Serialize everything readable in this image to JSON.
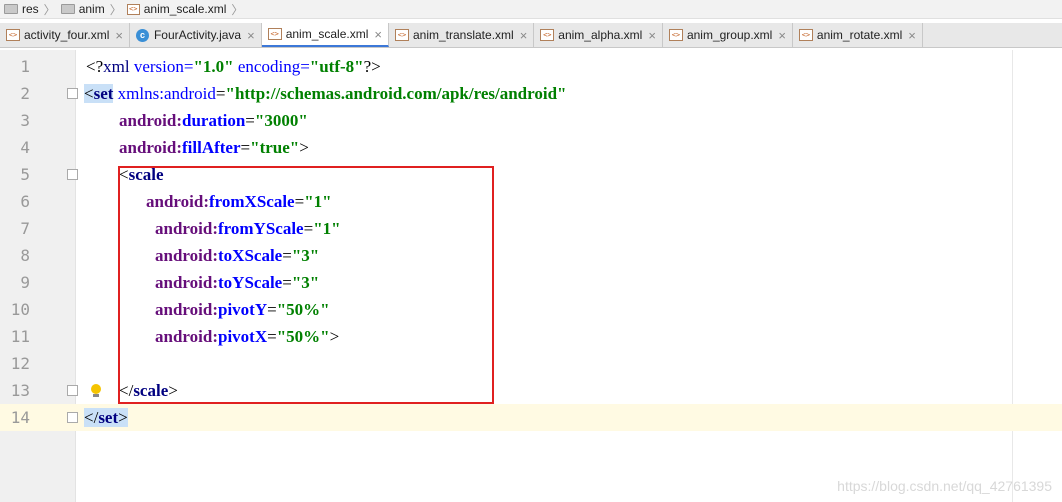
{
  "breadcrumb": [
    {
      "label": "res",
      "icon": "folder-icon"
    },
    {
      "label": "anim",
      "icon": "folder-icon"
    },
    {
      "label": "anim_scale.xml",
      "icon": "xml-file-icon"
    }
  ],
  "tabs": [
    {
      "label": "activity_four.xml",
      "icon": "xml-file-icon",
      "active": false
    },
    {
      "label": "FourActivity.java",
      "icon": "java-class-icon",
      "active": false
    },
    {
      "label": "anim_scale.xml",
      "icon": "xml-file-icon",
      "active": true
    },
    {
      "label": "anim_translate.xml",
      "icon": "xml-file-icon",
      "active": false
    },
    {
      "label": "anim_alpha.xml",
      "icon": "xml-file-icon",
      "active": false
    },
    {
      "label": "anim_group.xml",
      "icon": "xml-file-icon",
      "active": false
    },
    {
      "label": "anim_rotate.xml",
      "icon": "xml-file-icon",
      "active": false
    }
  ],
  "close_glyph": "×",
  "line_numbers": [
    "1",
    "2",
    "3",
    "4",
    "5",
    "6",
    "7",
    "8",
    "9",
    "10",
    "11",
    "12",
    "13",
    "14"
  ],
  "code": {
    "l1_open": "<?",
    "l1_xml": "xml",
    "l1_version_attr": " version=",
    "l1_version_val": "\"1.0\"",
    "l1_encoding_attr": " encoding=",
    "l1_encoding_val": "\"utf-8\"",
    "l1_close": "?>",
    "l2_lt": "<",
    "l2_tag": "set",
    "l2_ns": " xmlns:",
    "l2_nsname": "android",
    "l2_eq": "=",
    "l2_val": "\"http://schemas.android.com/apk/res/android\"",
    "l3_ns": "android:",
    "l3_name": "duration",
    "l3_val": "\"3000\"",
    "l4_ns": "android:",
    "l4_name": "fillAfter",
    "l4_val": "\"true\"",
    "l4_gt": ">",
    "l5_lt": "<",
    "l5_tag": "scale",
    "l6_ns": "android:",
    "l6_name": "fromXScale",
    "l6_val": "\"1\"",
    "l7_ns": "android:",
    "l7_name": "fromYScale",
    "l7_val": "\"1\"",
    "l8_ns": "android:",
    "l8_name": "toXScale",
    "l8_val": "\"3\"",
    "l9_ns": "android:",
    "l9_name": "toYScale",
    "l9_val": "\"3\"",
    "l10_ns": "android:",
    "l10_name": "pivotY",
    "l10_val": "\"50%\"",
    "l11_ns": "android:",
    "l11_name": "pivotX",
    "l11_val": "\"50%\"",
    "l11_gt": ">",
    "l13_open": "</",
    "l13_tag": "scale",
    "l13_gt": ">",
    "l14_open": "</",
    "l14_tag": "set",
    "l14_gt": ">",
    "eq": "="
  },
  "watermark": "https://blog.csdn.net/qq_42761395",
  "colors": {
    "tag": "#000080",
    "attribute_ns": "#660e7a",
    "attribute_name": "#0000ff",
    "value": "#008000",
    "highlight": "#c9e0f7",
    "current_line": "#fffae3",
    "annotation_box": "#e02020"
  }
}
